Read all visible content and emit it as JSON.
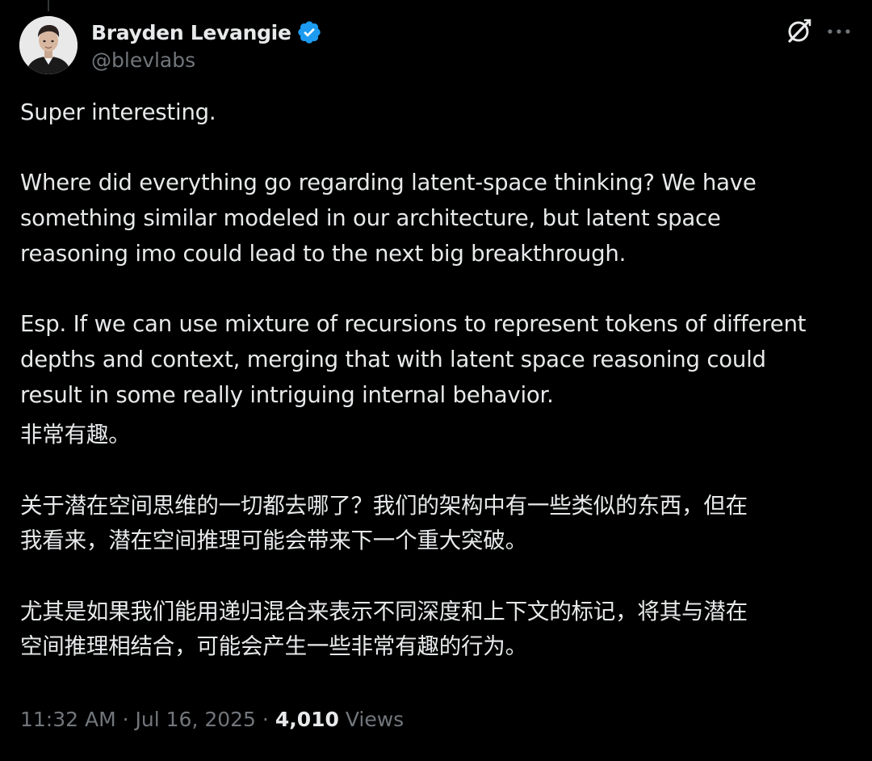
{
  "author": {
    "display_name": "Brayden Levangie",
    "handle": "@blevlabs",
    "verified": true
  },
  "icons": {
    "avatar": "avatar-photo",
    "verified": "verified-badge-icon",
    "grok": "grok-icon",
    "more": "more-options-icon"
  },
  "colors": {
    "background": "#000000",
    "text_primary": "#e7e9ea",
    "text_secondary": "#71767b",
    "verified_blue": "#1d9bf0"
  },
  "post": {
    "paragraphs": [
      "Super interesting.",
      "Where did everything go regarding latent-space thinking? We have\nsomething similar modeled in our architecture, but latent space\nreasoning imo could lead to the next big breakthrough.",
      "Esp. If we can use mixture of recursions to represent tokens of different\ndepths and context, merging that with latent space reasoning could\nresult in some really intriguing internal behavior.",
      "非常有趣。",
      "关于潜在空间思维的一切都去哪了？我们的架构中有一些类似的东西，但在\n我看来，潜在空间推理可能会带来下一个重大突破。",
      "尤其是如果我们能用递归混合来表示不同深度和上下文的标记，将其与潜在\n空间推理相结合，可能会产生一些非常有趣的行为。"
    ]
  },
  "meta": {
    "time": "11:32 AM",
    "separator": " · ",
    "date": "Jul 16, 2025",
    "views_count": "4,010",
    "views_label": "Views"
  }
}
